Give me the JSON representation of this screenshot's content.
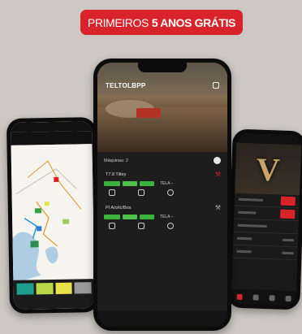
{
  "banner": {
    "text_light": "PRIMEIROS",
    "text_bold": "5 ANOS GRÁTIS"
  },
  "colors": {
    "brand_red": "#d8232a",
    "status_green": "#3bb33b",
    "background": "#cdc8c3"
  },
  "left_phone": {
    "legend_colors": [
      "#1f9e8e",
      "#b7d64a",
      "#e8e24a",
      "#aaa"
    ]
  },
  "center_phone": {
    "hero_title": "TELTOLBPP",
    "section_title": "Máquinas: 2",
    "machines": [
      {
        "name": "T7.8 Tiltey",
        "meta": "TELA --",
        "status_color": "#d8232a"
      },
      {
        "name": "PI A/o/tc/Bos",
        "meta": "TELA --",
        "status_color": "#999999"
      }
    ]
  },
  "right_phone": {
    "logo": "V"
  }
}
